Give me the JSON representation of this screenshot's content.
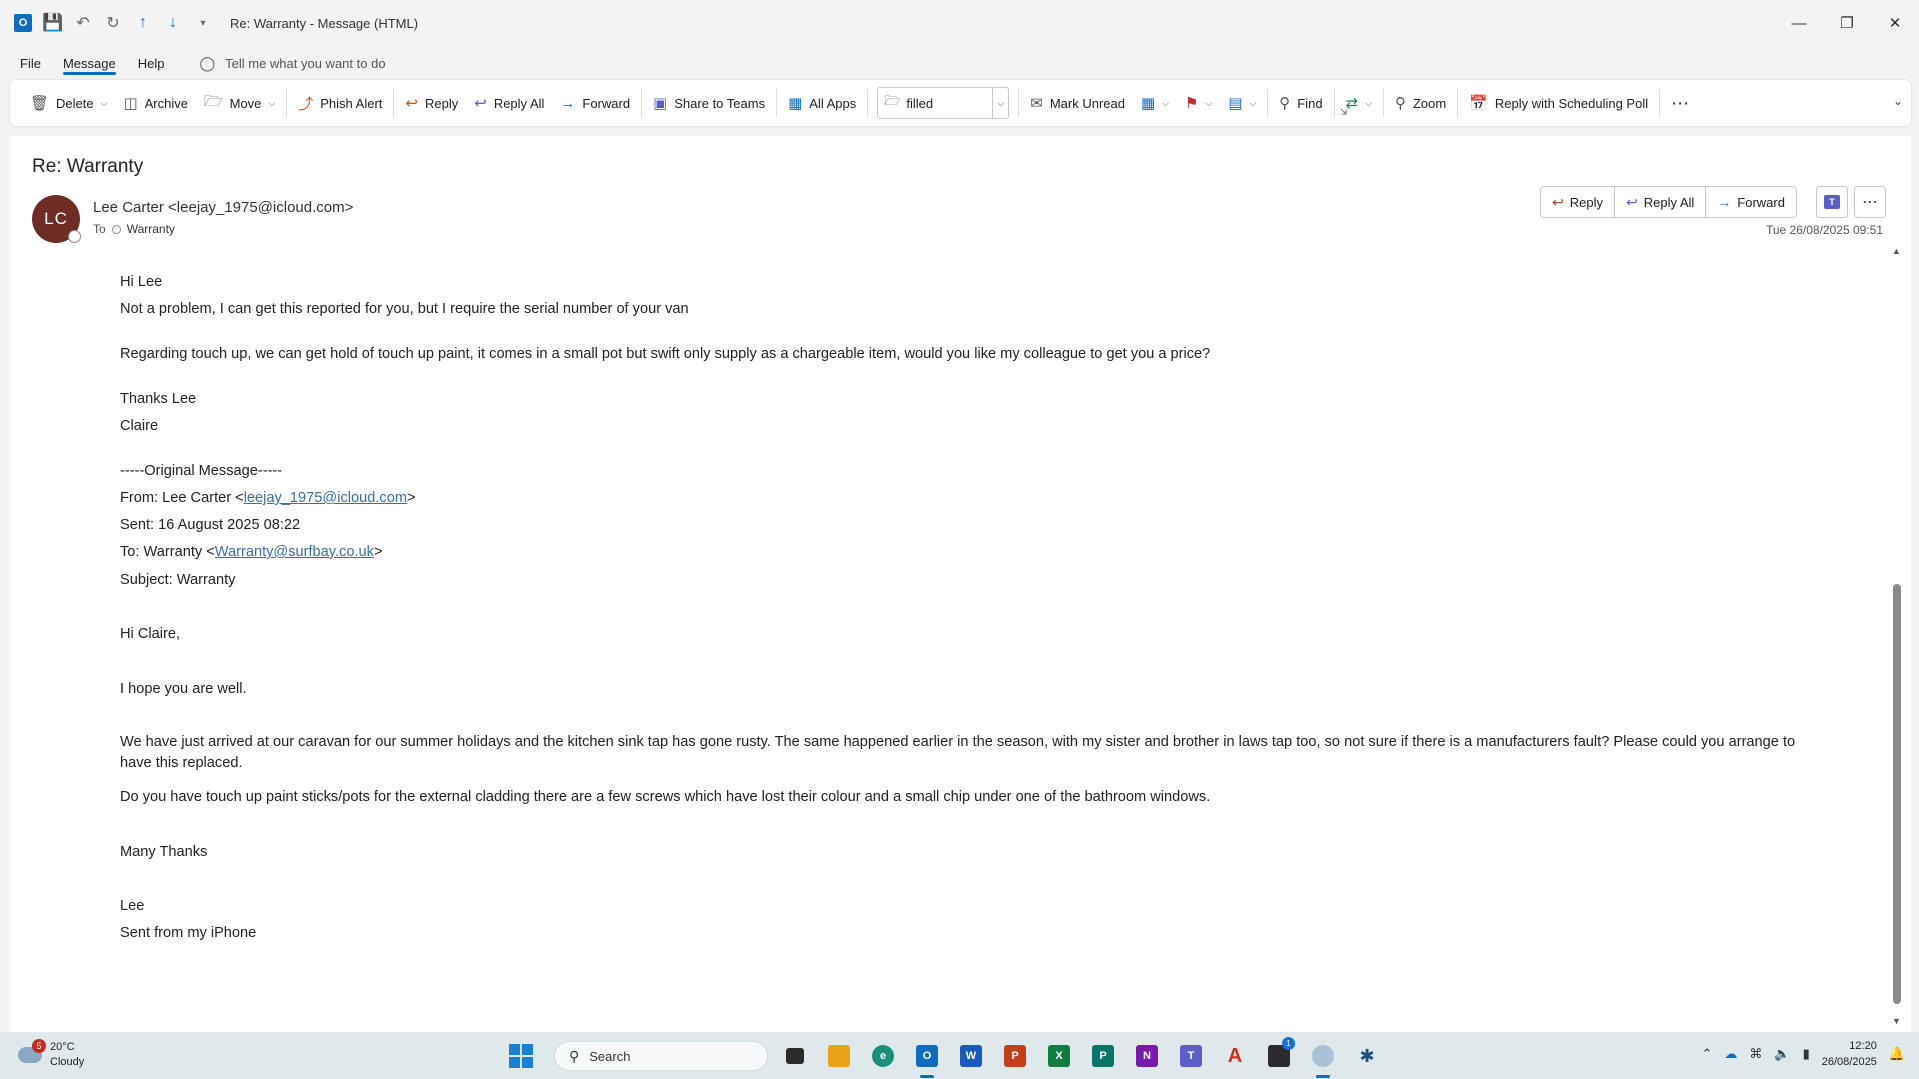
{
  "window": {
    "title": "Re: Warranty  -  Message (HTML)"
  },
  "menu": {
    "tabs": [
      "File",
      "Message",
      "Help"
    ],
    "tell_me": "Tell me what you want to do"
  },
  "ribbon": {
    "delete": "Delete",
    "archive": "Archive",
    "move": "Move",
    "phish_alert": "Phish Alert",
    "reply": "Reply",
    "reply_all": "Reply All",
    "forward": "Forward",
    "share_to_teams": "Share to Teams",
    "all_apps": "All Apps",
    "folder_value": "filled",
    "mark_unread": "Mark Unread",
    "find": "Find",
    "zoom": "Zoom",
    "reply_poll": "Reply with Scheduling Poll"
  },
  "message": {
    "subject": "Re: Warranty",
    "avatar_initials": "LC",
    "sender": "Lee Carter <leejay_1975@icloud.com>",
    "to_label": "To",
    "to_name": "Warranty",
    "date": "Tue 26/08/2025 09:51",
    "actions": {
      "reply": "Reply",
      "reply_all": "Reply All",
      "forward": "Forward"
    },
    "body": {
      "greeting": "Hi Lee",
      "line1": "Not a problem, I can get this reported for you, but I require the serial number of your van",
      "line2": "Regarding touch up, we can get hold of touch up paint, it comes in a small pot but swift only supply as a chargeable item, would you like my colleague to get you a price?",
      "thanks": "Thanks Lee",
      "sign": "Claire",
      "original_header": "-----Original Message-----",
      "from_prefix": "From: Lee Carter <",
      "from_email": "leejay_1975@icloud.com",
      "from_suffix": ">",
      "sent": "Sent: 16 August 2025 08:22",
      "to_prefix": "To: Warranty <",
      "to_email": "Warranty@surfbay.co.uk",
      "to_suffix": ">",
      "subject_line": "Subject: Warranty",
      "orig_greeting": "Hi Claire,",
      "orig_line1": "I hope you are well.",
      "orig_line2": "We have just arrived at our caravan for our summer holidays and the kitchen sink tap has gone rusty. The same happened earlier in the  season, with my sister and brother in laws tap too, so not sure if there is a manufacturers fault? Please could you arrange to have this replaced.",
      "orig_line3": "Do you have touch up paint sticks/pots for the external cladding there are a few screws which have lost their colour and a small chip under one of the bathroom windows.",
      "orig_thanks": "Many Thanks",
      "orig_sign": "Lee",
      "orig_footer": "Sent from my iPhone"
    }
  },
  "taskbar": {
    "weather_temp": "20°C",
    "weather_desc": "Cloudy",
    "weather_badge": "5",
    "search_placeholder": "Search",
    "teams_badge": "1",
    "time": "12:20",
    "date": "26/08/2025"
  },
  "colors": {
    "accent": "#0f6cbd",
    "avatar_bg": "#6e2c24",
    "link": "#3b6ea3"
  }
}
